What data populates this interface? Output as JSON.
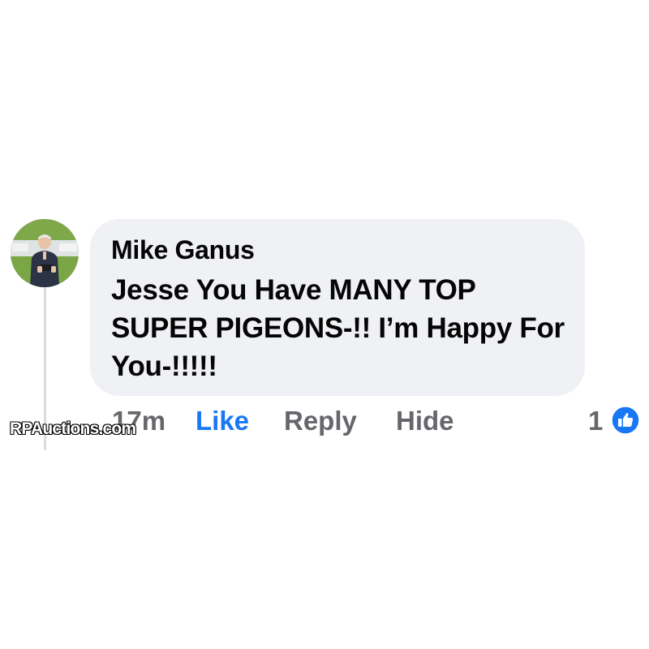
{
  "comment": {
    "author": "Mike Ganus",
    "text": "Jesse You Have MANY TOP SUPER PIGEONS-!! I’m Happy For You-!!!!!",
    "timestamp": "17m",
    "reaction_count": "1"
  },
  "actions": {
    "like_label": "Like",
    "reply_label": "Reply",
    "hide_label": "Hide"
  },
  "watermark": "RPAuctions.com",
  "icons": {
    "reaction": "thumbs-up-icon",
    "avatar": "profile-photo"
  },
  "colors": {
    "bubble_bg": "#f0f1f5",
    "like_blue": "#1877f2",
    "secondary_text": "#65676b",
    "primary_text": "#050505"
  }
}
